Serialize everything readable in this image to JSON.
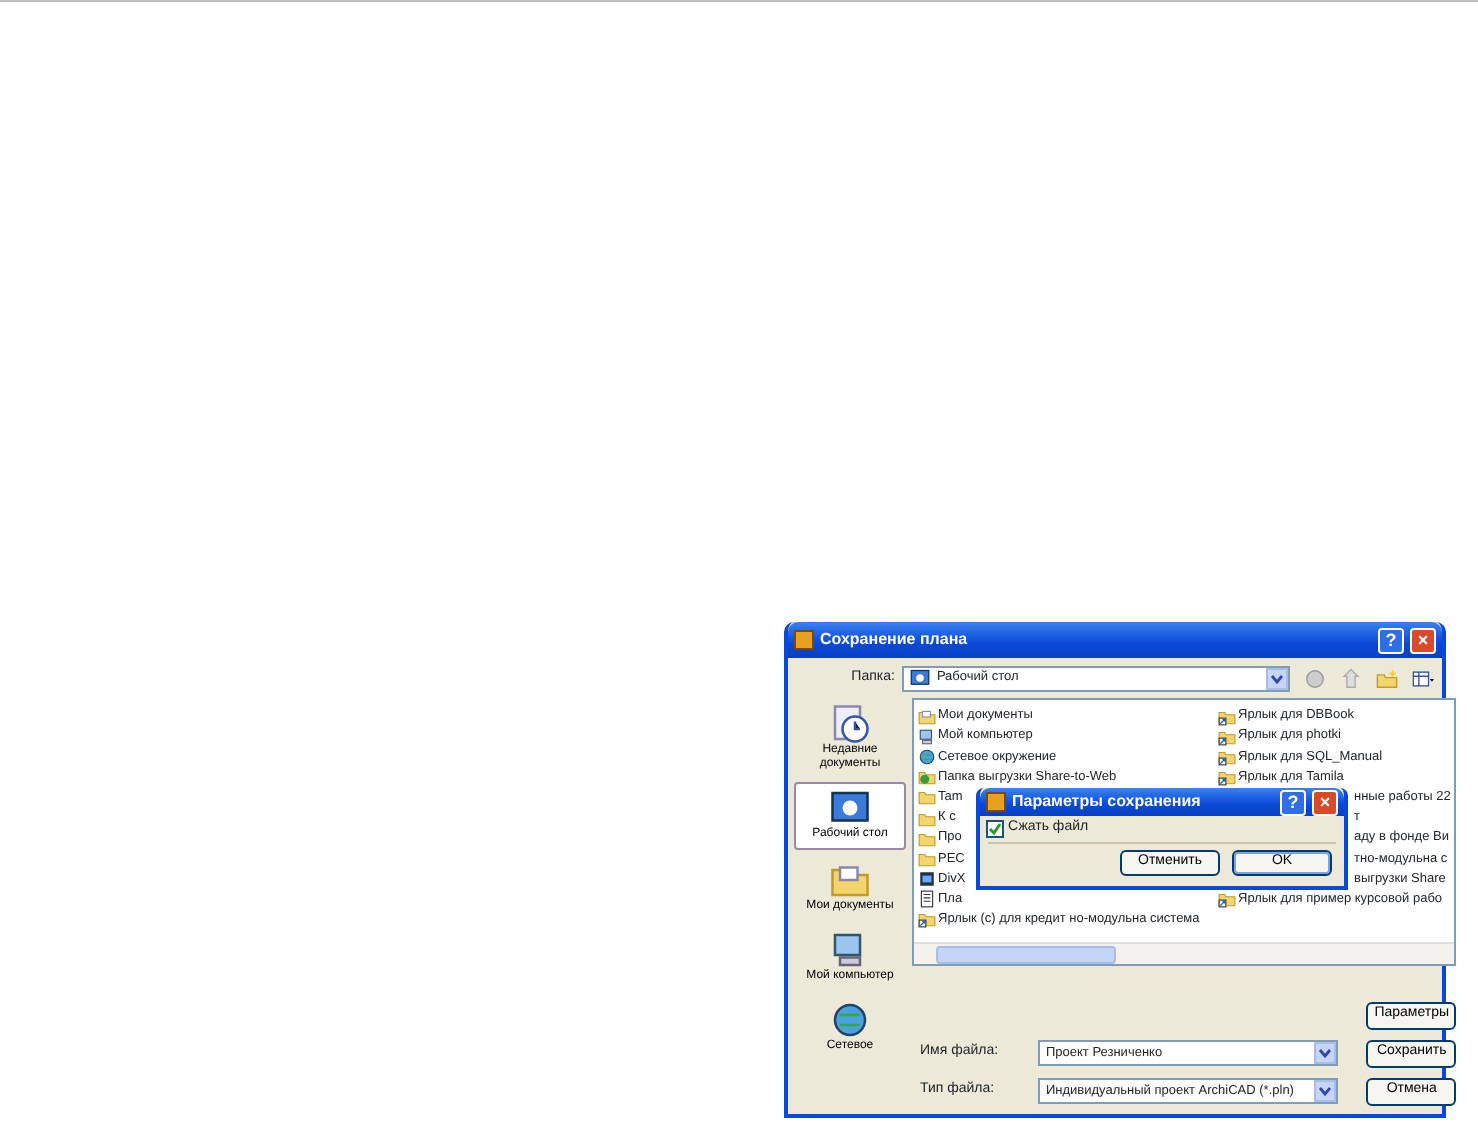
{
  "window": {
    "title": "Сохранение плана",
    "help": "?",
    "close": "×"
  },
  "folder": {
    "label": "Папка:",
    "value": "Рабочий стол"
  },
  "places": [
    {
      "label": "Недавние документы",
      "kind": "recent",
      "selected": false
    },
    {
      "label": "Рабочий стол",
      "kind": "desktop",
      "selected": true
    },
    {
      "label": "Мои документы",
      "kind": "documents",
      "selected": false
    },
    {
      "label": "Мой компьютер",
      "kind": "computer",
      "selected": false
    },
    {
      "label": "Сетевое",
      "kind": "network",
      "selected": false
    }
  ],
  "file_list": {
    "column_1": [
      {
        "name": "Мои документы",
        "kind": "documents"
      },
      {
        "name": "Мой компьютер",
        "kind": "computer"
      },
      {
        "name": "Сетевое окружение",
        "kind": "network"
      },
      {
        "name": "Папка выгрузки Share-to-Web",
        "kind": "share"
      },
      {
        "name": "Tam",
        "kind": "folder"
      },
      {
        "name": "К с",
        "kind": "folder"
      },
      {
        "name": "Про",
        "kind": "folder"
      },
      {
        "name": "PEC",
        "kind": "folder"
      },
      {
        "name": "DivX",
        "kind": "divx"
      },
      {
        "name": "Пла",
        "kind": "plan"
      },
      {
        "name": "Ярлык (с) для кредит но-модульна система",
        "kind": "shortcut"
      }
    ],
    "column_2": [
      {
        "name": "Ярлык для DBBook",
        "kind": "shortcut"
      },
      {
        "name": "Ярлык для photki",
        "kind": "shortcut"
      },
      {
        "name": "Ярлык для SQL_Manual",
        "kind": "shortcut"
      },
      {
        "name": "Ярлык для Tamila",
        "kind": "shortcut"
      },
      {
        "name": "нные работы 22",
        "kind": "covered"
      },
      {
        "name": "т",
        "kind": "covered"
      },
      {
        "name": "аду в фонде Ви",
        "kind": "covered"
      },
      {
        "name": "тно-модульна с",
        "kind": "covered"
      },
      {
        "name": "выгрузки Share",
        "kind": "covered"
      },
      {
        "name": "Ярлык для пример курсовой рабо",
        "kind": "shortcut"
      }
    ]
  },
  "options_button": "Параметры",
  "file_name": {
    "label": "Имя файла:",
    "value": "Проект Резниченко"
  },
  "file_type": {
    "label": "Тип файла:",
    "value": "Индивидуальный проект ArchiCAD (*.pln)"
  },
  "buttons": [
    "Сохранить",
    "Отмена"
  ],
  "options_dialog": {
    "title": "Параметры сохранения",
    "help": "?",
    "close": "×",
    "compress": {
      "label": "Сжать файл",
      "checked": true
    },
    "buttons": [
      {
        "label": "Отменить",
        "default": false
      },
      {
        "label": "OK",
        "default": true
      }
    ]
  }
}
